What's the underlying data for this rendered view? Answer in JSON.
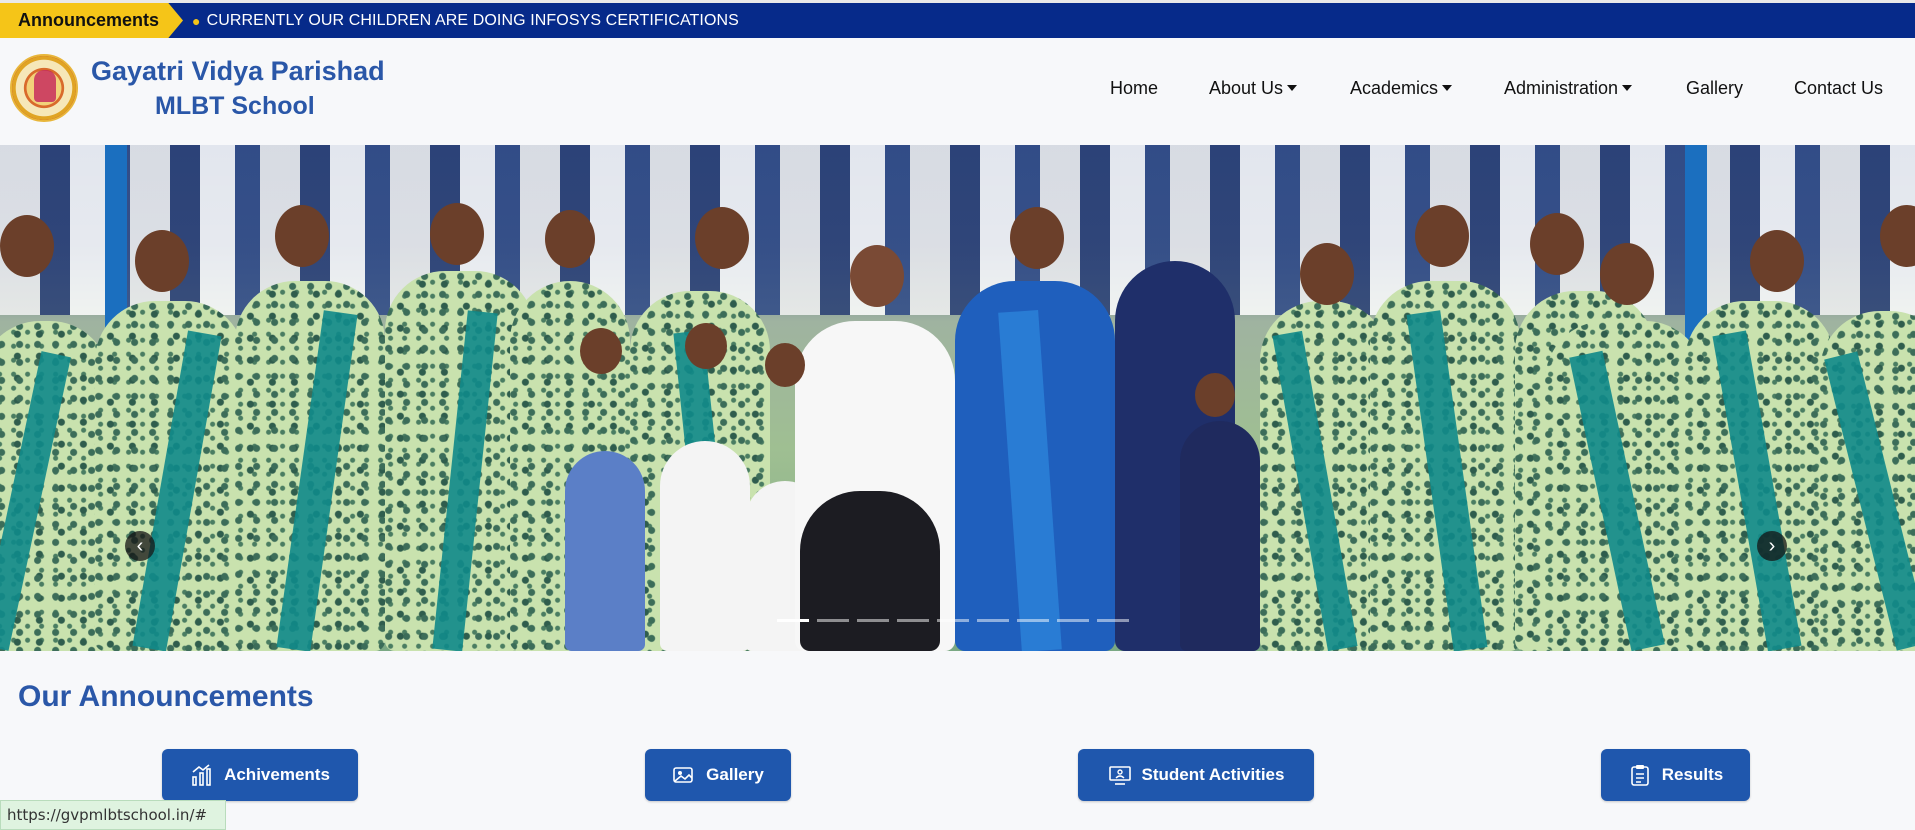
{
  "ticker": {
    "label": "Announcements",
    "text": "CURRENTLY OUR CHILDREN ARE DOING INFOSYS CERTIFICATIONS",
    "bullet": "●"
  },
  "brand": {
    "line1": "Gayatri Vidya Parishad",
    "line2": "MLBT School",
    "color": "#2a57a8"
  },
  "nav": {
    "items": [
      {
        "label": "Home",
        "dropdown": false
      },
      {
        "label": "About Us",
        "dropdown": true
      },
      {
        "label": "Academics",
        "dropdown": true
      },
      {
        "label": "Administration",
        "dropdown": true
      },
      {
        "label": "Gallery",
        "dropdown": false
      },
      {
        "label": "Contact Us",
        "dropdown": false
      }
    ]
  },
  "carousel": {
    "prev_glyph": "‹",
    "next_glyph": "›",
    "slide_count": 9,
    "active_slide": 1
  },
  "announcements": {
    "title": "Our Announcements",
    "buttons": [
      {
        "label": "Achivements",
        "icon": "chart-up-icon"
      },
      {
        "label": "Gallery",
        "icon": "image-icon"
      },
      {
        "label": "Student Activities",
        "icon": "presentation-icon"
      },
      {
        "label": "Results",
        "icon": "clipboard-icon"
      }
    ]
  },
  "statusbar": {
    "url": "https://gvpmlbtschool.in/#"
  },
  "colors": {
    "ticker_bg": "#062a8a",
    "ticker_label_bg": "#f5c518",
    "button_bg": "#1f57ad"
  }
}
